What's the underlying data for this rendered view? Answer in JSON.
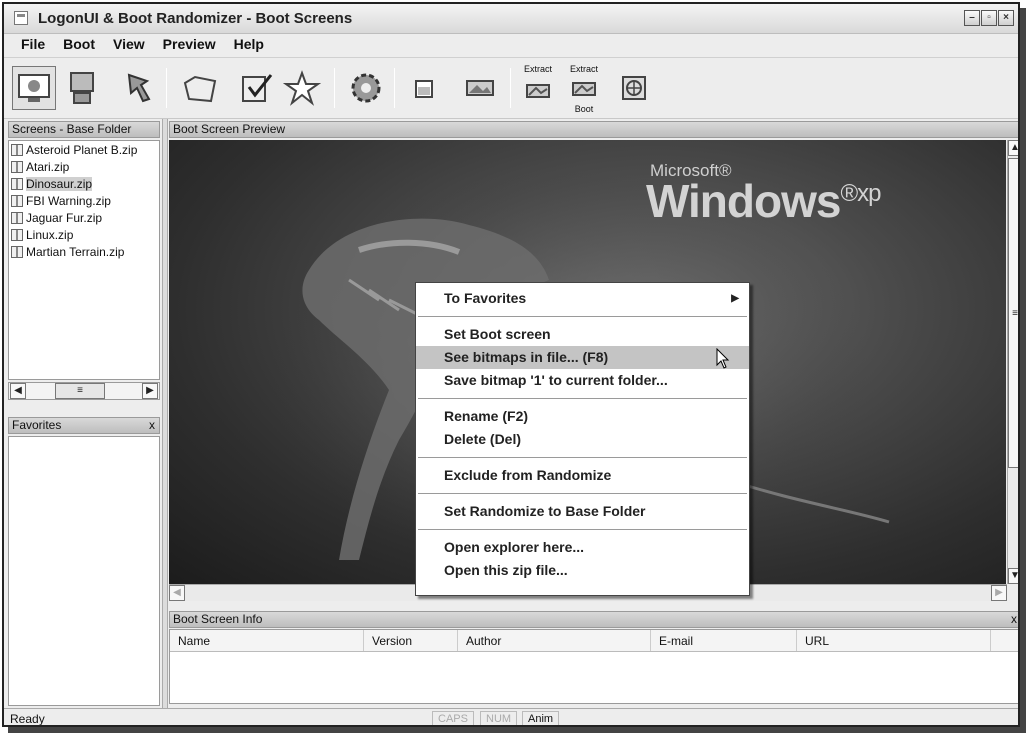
{
  "window": {
    "title": "LogonUI & Boot Randomizer - Boot Screens"
  },
  "menu": [
    "File",
    "Boot",
    "View",
    "Preview",
    "Help"
  ],
  "toolbar": {
    "extract_label": "Extract",
    "extract_boot_label": "Extract",
    "extract_boot_sub": "Boot"
  },
  "screens": {
    "header": "Screens - Base Folder",
    "items": [
      "Asteroid Planet B.zip",
      "Atari.zip",
      "Dinosaur.zip",
      "FBI Warning.zip",
      "Jaguar Fur.zip",
      "Linux.zip",
      "Martian Terrain.zip"
    ],
    "selected": "Dinosaur.zip"
  },
  "favorites": {
    "header": "Favorites",
    "close": "x"
  },
  "preview": {
    "header": "Boot Screen Preview",
    "brand_small": "Microsoft®",
    "brand_big": "Windows",
    "brand_sup": "®xp"
  },
  "context_menu": {
    "to_favorites": "To Favorites",
    "set_boot": "Set Boot screen",
    "see_bitmaps": "See bitmaps in file... (F8)",
    "save_bitmap": "Save bitmap '1' to current folder...",
    "rename": "Rename (F2)",
    "delete": "Delete (Del)",
    "exclude": "Exclude from Randomize",
    "set_randomize": "Set Randomize to Base Folder",
    "open_explorer": "Open explorer here...",
    "open_zip": "Open this zip file..."
  },
  "info": {
    "header": "Boot Screen Info",
    "close": "x",
    "columns": [
      "Name",
      "Version",
      "Author",
      "E-mail",
      "URL"
    ]
  },
  "status": {
    "text": "Ready",
    "caps": "CAPS",
    "num": "NUM",
    "anim": "Anim"
  }
}
